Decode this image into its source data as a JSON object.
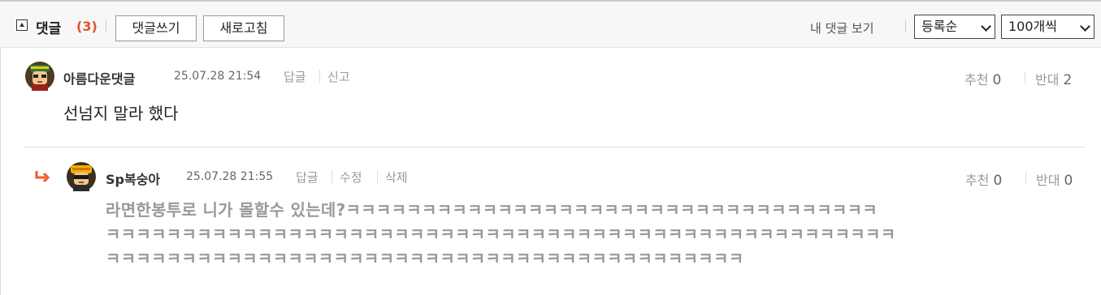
{
  "header": {
    "title": "댓글",
    "count": "(3)",
    "write_button": "댓글쓰기",
    "refresh_button": "새로고침",
    "my_comments_link": "내 댓글 보기",
    "sort_select": "등록순",
    "page_size_select": "100개씩"
  },
  "comments": [
    {
      "nickname": "아름다운댓글",
      "date": "25.07.28 21:54",
      "actions": [
        "답글",
        "신고"
      ],
      "recommend_label": "추천",
      "recommend_count": "0",
      "oppose_label": "반대",
      "oppose_count": "2",
      "body": "선넘지 말라 했다"
    },
    {
      "nickname": "Sp복숭아",
      "date": "25.07.28 21:55",
      "actions": [
        "답글",
        "수정",
        "삭제"
      ],
      "recommend_label": "추천",
      "recommend_count": "0",
      "oppose_label": "반대",
      "oppose_count": "0",
      "body_lines": [
        "라면한봉투로 니가 몰할수 있는데?ㅋㅋㅋㅋㅋㅋㅋㅋㅋㅋㅋㅋㅋㅋㅋㅋㅋㅋㅋㅋㅋㅋㅋㅋㅋㅋㅋㅋㅋㅋㅋㅋㅋㅋㅋ",
        "ㅋㅋㅋㅋㅋㅋㅋㅋㅋㅋㅋㅋㅋㅋㅋㅋㅋㅋㅋㅋㅋㅋㅋㅋㅋㅋㅋㅋㅋㅋㅋㅋㅋㅋㅋㅋㅋㅋㅋㅋㅋㅋㅋㅋㅋㅋㅋㅋㅋㅋㅋㅋ",
        "ㅋㅋㅋㅋㅋㅋㅋㅋㅋㅋㅋㅋㅋㅋㅋㅋㅋㅋㅋㅋㅋㅋㅋㅋㅋㅋㅋㅋㅋㅋㅋㅋㅋㅋㅋㅋㅋㅋㅋㅋㅋㅋ"
      ]
    }
  ],
  "colors": {
    "count": "#e4502d",
    "reply_arrow": "#f05a28"
  },
  "icons": {
    "collapse": "collapse-up-icon",
    "reply": "reply-arrow-icon",
    "dropdown": "chevron-down-icon"
  }
}
